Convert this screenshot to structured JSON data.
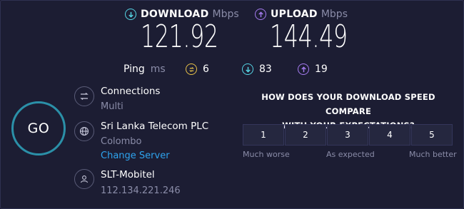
{
  "download": {
    "title": "DOWNLOAD",
    "unit": "Mbps",
    "value": "121.92"
  },
  "upload": {
    "title": "UPLOAD",
    "unit": "Mbps",
    "value": "144.49"
  },
  "ping": {
    "label": "Ping",
    "unit": "ms",
    "jitter": "6",
    "down": "83",
    "up": "19"
  },
  "go_label": "GO",
  "connections": {
    "title": "Connections",
    "value": "Multi"
  },
  "server": {
    "name": "Sri Lanka Telecom PLC",
    "location": "Colombo",
    "change_label": "Change Server"
  },
  "provider": {
    "name": "SLT-Mobitel",
    "ip": "112.134.221.246"
  },
  "survey": {
    "question_line1": "HOW DOES YOUR DOWNLOAD SPEED COMPARE",
    "question_line2": "WITH YOUR EXPECTATIONS?",
    "options": [
      "1",
      "2",
      "3",
      "4",
      "5"
    ],
    "hint_low": "Much worse",
    "hint_mid": "As expected",
    "hint_high": "Much better"
  },
  "colors": {
    "download": "#56d6e6",
    "upload": "#a57bf0",
    "jitter": "#e8c24a",
    "link": "#2ea4ef",
    "go_ring": "#2b90a8"
  }
}
